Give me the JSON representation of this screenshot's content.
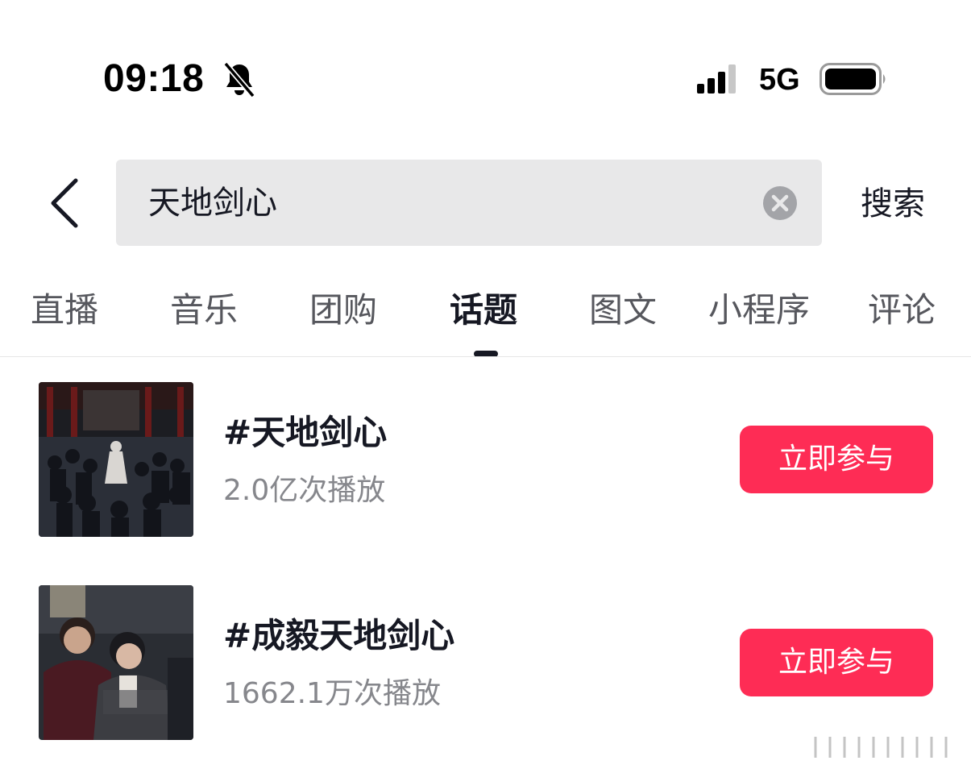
{
  "status_bar": {
    "time": "09:18",
    "network": "5G",
    "icons": [
      "bell-muted-icon",
      "signal-icon",
      "battery-icon"
    ]
  },
  "search": {
    "query": "天地剑心",
    "submit_label": "搜索",
    "icons": [
      "back-arrow-icon",
      "clear-icon"
    ]
  },
  "tabs": [
    {
      "label": "直播",
      "active": false
    },
    {
      "label": "音乐",
      "active": false
    },
    {
      "label": "团购",
      "active": false
    },
    {
      "label": "话题",
      "active": true
    },
    {
      "label": "图文",
      "active": false
    },
    {
      "label": "小程序",
      "active": false
    },
    {
      "label": "评论",
      "active": false
    }
  ],
  "topics": [
    {
      "title": "#天地剑心",
      "plays": "2.0亿次播放",
      "action_label": "立即参与"
    },
    {
      "title": "#成毅天地剑心",
      "plays": "1662.1万次播放",
      "action_label": "立即参与"
    }
  ],
  "colors": {
    "accent": "#fe2c55",
    "text_primary": "#161823",
    "text_secondary": "#86878c",
    "search_bg": "#e8e8e9"
  }
}
